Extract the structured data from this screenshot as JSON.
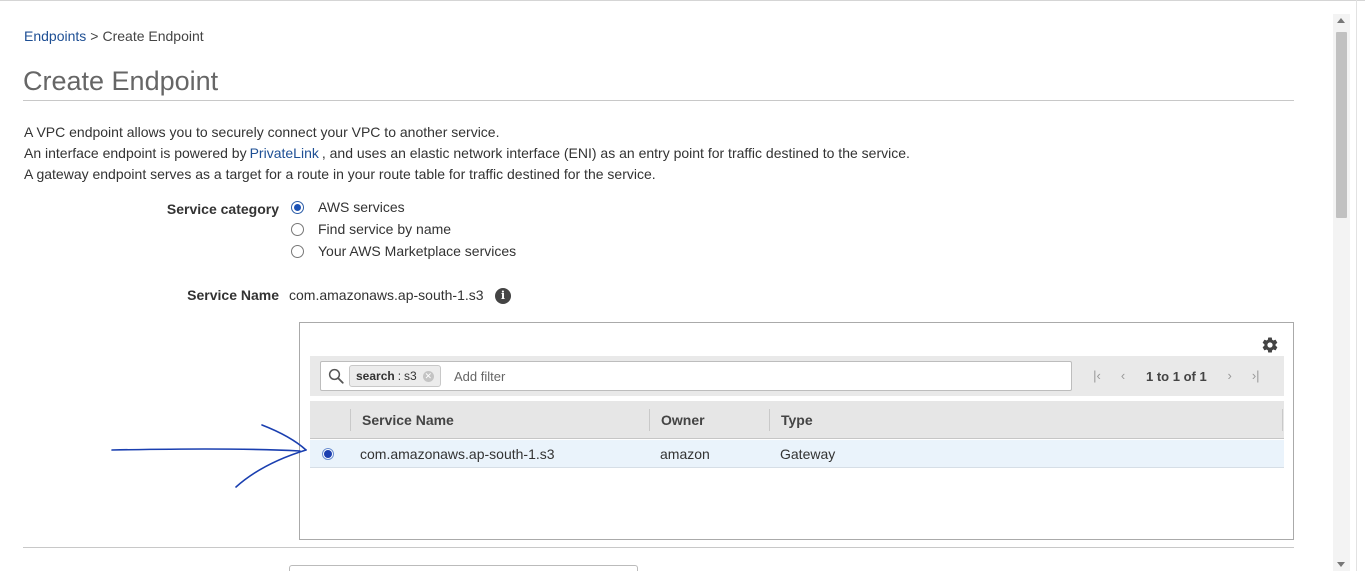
{
  "breadcrumb": {
    "link": "Endpoints",
    "separator": ">",
    "current": "Create Endpoint"
  },
  "page": {
    "title": "Create Endpoint"
  },
  "description": {
    "line1": "A VPC endpoint allows you to securely connect your VPC to another service.",
    "line2_before": "An interface endpoint is powered by",
    "line2_link": "PrivateLink",
    "line2_after": ", and uses an elastic network interface (ENI) as an entry point for traffic destined to the service.",
    "line3": "A gateway endpoint serves as a target for a route in your route table for traffic destined for the service."
  },
  "service_category": {
    "label": "Service category",
    "options": [
      {
        "label": "AWS services",
        "selected": true
      },
      {
        "label": "Find service by name",
        "selected": false
      },
      {
        "label": "Your AWS Marketplace services",
        "selected": false
      }
    ]
  },
  "service_name": {
    "label": "Service Name",
    "value": "com.amazonaws.ap-south-1.s3",
    "info_icon": "info-icon"
  },
  "table": {
    "settings_icon": "gear-icon",
    "filter": {
      "search_icon": "search-icon",
      "token_key": "search",
      "token_sep": ":",
      "token_value": "s3",
      "placeholder": "Add filter"
    },
    "pagination": {
      "text": "1 to 1 of 1",
      "first_glyph": "|<",
      "prev_glyph": "<",
      "next_glyph": ">",
      "last_glyph": ">|"
    },
    "columns": [
      "Service Name",
      "Owner",
      "Type"
    ],
    "rows": [
      {
        "selected": true,
        "service_name": "com.amazonaws.ap-south-1.s3",
        "owner": "amazon",
        "type": "Gateway"
      }
    ]
  },
  "colors": {
    "link": "#1e4f94",
    "radio_selected": "#1c52b5",
    "selected_row": "#eaf3fb",
    "annotation_ink": "#1a3fb0"
  }
}
